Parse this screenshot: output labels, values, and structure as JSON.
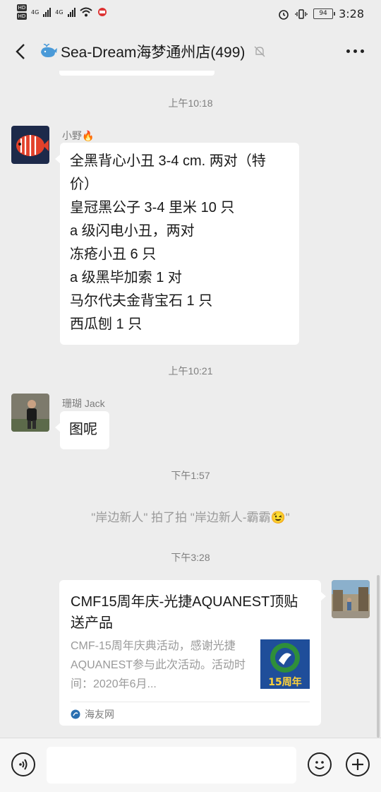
{
  "status_bar": {
    "time": "3:28",
    "battery": "94",
    "net_1": "4G",
    "net_2": "4G"
  },
  "header": {
    "title": "Sea-Dream海梦通州店(499)"
  },
  "messages": [
    {
      "time": "上午10:18",
      "sender": "小野🔥",
      "lines": [
        "全黑背心小丑 3-4 cm. 两对（特",
        "价）",
        "皇冠黑公子 3-4 里米 10 只",
        "a 级闪电小丑，两对",
        "冻疮小丑 6 只",
        "a 级黑毕加索 1 对",
        "马尔代夫金背宝石 1 只",
        "西瓜刨 1 只"
      ]
    },
    {
      "time": "上午10:21",
      "sender": "珊瑚  Jack",
      "text": "图呢"
    },
    {
      "time": "下午1:57",
      "system": "\"岸边新人\" 拍了拍 \"岸边新人-霸霸😉\""
    },
    {
      "time": "下午3:28",
      "card": {
        "title": "CMF15周年庆-光捷AQUANEST顶贴送产品",
        "description": "CMF-15周年庆典活动，感谢光捷AQUANEST参与此次活动。活动时间：2020年6月...",
        "thumbnail_text": "15周年",
        "source": "海友网"
      }
    }
  ],
  "colors": {
    "background": "#ededed",
    "bubble": "#ffffff",
    "muted_text": "#7f7f7f",
    "card_thumb_blue": "#1f4e9a",
    "card_thumb_green": "#2f8f3a"
  }
}
